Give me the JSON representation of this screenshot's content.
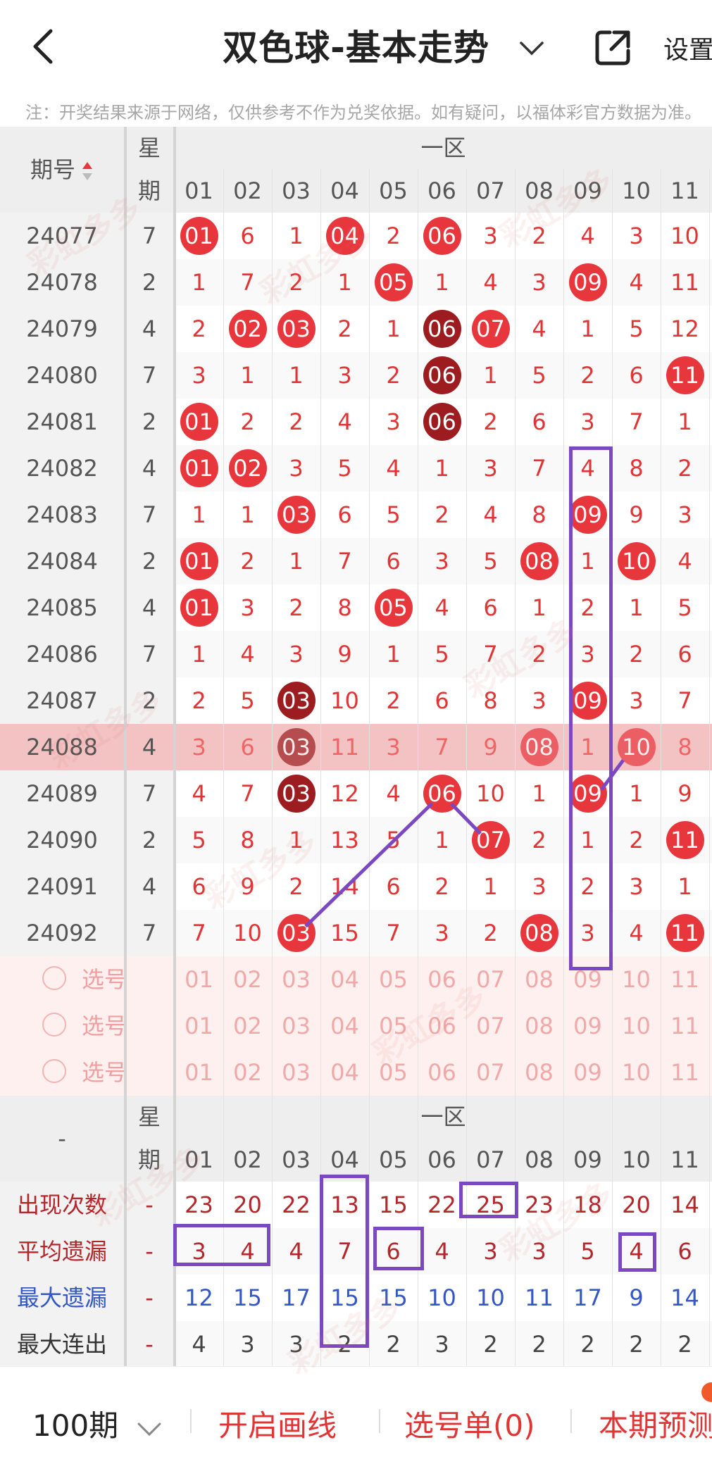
{
  "header": {
    "title": "双色球-基本走势",
    "settings_label": "设置"
  },
  "note": "注：开奖结果来源于网络，仅供参考不作为兑奖依据。如有疑问，以福体彩官方数据为准。",
  "table": {
    "issue_header": "期号",
    "weekday_header_1": "星",
    "weekday_header_2": "期",
    "zone_label": "一区",
    "columns": [
      "01",
      "02",
      "03",
      "04",
      "05",
      "06",
      "07",
      "08",
      "09",
      "10",
      "11"
    ],
    "rows": [
      {
        "issue": "24077",
        "wk": "7",
        "cells": [
          "01",
          "6",
          "1",
          "04",
          "2",
          "06",
          "3",
          "2",
          "4",
          "3",
          "10"
        ],
        "balls": [
          0,
          3,
          5
        ],
        "dark": []
      },
      {
        "issue": "24078",
        "wk": "2",
        "cells": [
          "1",
          "7",
          "2",
          "1",
          "05",
          "1",
          "4",
          "3",
          "09",
          "4",
          "11"
        ],
        "balls": [
          4,
          8
        ],
        "dark": []
      },
      {
        "issue": "24079",
        "wk": "4",
        "cells": [
          "2",
          "02",
          "03",
          "2",
          "1",
          "06",
          "07",
          "4",
          "1",
          "5",
          "12"
        ],
        "balls": [
          1,
          2,
          5,
          6
        ],
        "dark": [
          5
        ]
      },
      {
        "issue": "24080",
        "wk": "7",
        "cells": [
          "3",
          "1",
          "1",
          "3",
          "2",
          "06",
          "1",
          "5",
          "2",
          "6",
          "11"
        ],
        "balls": [
          5,
          10
        ],
        "dark": [
          5
        ]
      },
      {
        "issue": "24081",
        "wk": "2",
        "cells": [
          "01",
          "2",
          "2",
          "4",
          "3",
          "06",
          "2",
          "6",
          "3",
          "7",
          "1"
        ],
        "balls": [
          0,
          5
        ],
        "dark": [
          5
        ]
      },
      {
        "issue": "24082",
        "wk": "4",
        "cells": [
          "01",
          "02",
          "3",
          "5",
          "4",
          "1",
          "3",
          "7",
          "4",
          "8",
          "2"
        ],
        "balls": [
          0,
          1
        ],
        "dark": []
      },
      {
        "issue": "24083",
        "wk": "7",
        "cells": [
          "1",
          "1",
          "03",
          "6",
          "5",
          "2",
          "4",
          "8",
          "09",
          "9",
          "3"
        ],
        "balls": [
          2,
          8
        ],
        "dark": []
      },
      {
        "issue": "24084",
        "wk": "2",
        "cells": [
          "01",
          "2",
          "1",
          "7",
          "6",
          "3",
          "5",
          "08",
          "1",
          "10",
          "4"
        ],
        "balls": [
          0,
          7,
          9
        ],
        "dark": []
      },
      {
        "issue": "24085",
        "wk": "4",
        "cells": [
          "01",
          "3",
          "2",
          "8",
          "05",
          "4",
          "6",
          "1",
          "2",
          "1",
          "5"
        ],
        "balls": [
          0,
          4
        ],
        "dark": []
      },
      {
        "issue": "24086",
        "wk": "7",
        "cells": [
          "1",
          "4",
          "3",
          "9",
          "1",
          "5",
          "7",
          "2",
          "3",
          "2",
          "6"
        ],
        "balls": [],
        "dark": []
      },
      {
        "issue": "24087",
        "wk": "2",
        "cells": [
          "2",
          "5",
          "03",
          "10",
          "2",
          "6",
          "8",
          "3",
          "09",
          "3",
          "7"
        ],
        "balls": [
          2,
          8
        ],
        "dark": [
          2
        ]
      },
      {
        "issue": "24088",
        "wk": "4",
        "cells": [
          "3",
          "6",
          "03",
          "11",
          "3",
          "7",
          "9",
          "08",
          "1",
          "10",
          "8"
        ],
        "balls": [
          2,
          7,
          9
        ],
        "dark": [
          2
        ]
      },
      {
        "issue": "24089",
        "wk": "7",
        "cells": [
          "4",
          "7",
          "03",
          "12",
          "4",
          "06",
          "10",
          "1",
          "09",
          "1",
          "9"
        ],
        "balls": [
          2,
          5,
          8
        ],
        "dark": [
          2
        ]
      },
      {
        "issue": "24090",
        "wk": "2",
        "cells": [
          "5",
          "8",
          "1",
          "13",
          "5",
          "1",
          "07",
          "2",
          "1",
          "2",
          "11"
        ],
        "balls": [
          6,
          10
        ],
        "dark": []
      },
      {
        "issue": "24091",
        "wk": "4",
        "cells": [
          "6",
          "9",
          "2",
          "14",
          "6",
          "2",
          "1",
          "3",
          "2",
          "3",
          "1"
        ],
        "balls": [],
        "dark": []
      },
      {
        "issue": "24092",
        "wk": "7",
        "cells": [
          "7",
          "10",
          "03",
          "15",
          "7",
          "3",
          "2",
          "08",
          "3",
          "4",
          "11"
        ],
        "balls": [
          2,
          7,
          10
        ],
        "dark": []
      }
    ],
    "select_label": "选号",
    "stats_dash": "-",
    "stats": [
      {
        "label": "出现次数",
        "color": "#b3262a",
        "wk": "-",
        "cells": [
          "23",
          "20",
          "22",
          "13",
          "15",
          "22",
          "25",
          "23",
          "18",
          "20",
          "14"
        ]
      },
      {
        "label": "平均遗漏",
        "color": "#b3262a",
        "wk": "-",
        "cells": [
          "3",
          "4",
          "4",
          "7",
          "6",
          "4",
          "3",
          "3",
          "5",
          "4",
          "6"
        ]
      },
      {
        "label": "最大遗漏",
        "color": "#3357c4",
        "wk": "-",
        "cells": [
          "12",
          "15",
          "17",
          "15",
          "15",
          "10",
          "10",
          "11",
          "17",
          "9",
          "14"
        ]
      },
      {
        "label": "最大连出",
        "color": "#333333",
        "wk": "-",
        "cells": [
          "4",
          "3",
          "3",
          "2",
          "2",
          "3",
          "2",
          "2",
          "2",
          "2",
          "2"
        ]
      }
    ]
  },
  "bottom": {
    "periods": "100期",
    "draw_lines": "开启画线",
    "pick_list": "选号单(0)",
    "forecast": "本期预测"
  },
  "watermark": "彩虹多多",
  "colors": {
    "ball": "#e8363d",
    "ball_dark": "#9c1c1f",
    "annotation": "#7b48c2",
    "highlight_row": "#f3c2c2"
  }
}
